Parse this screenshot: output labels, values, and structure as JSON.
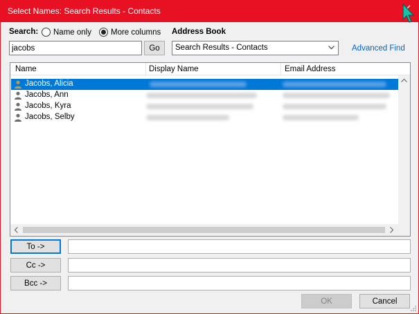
{
  "window": {
    "title": "Select Names: Search Results - Contacts"
  },
  "search": {
    "label": "Search:",
    "options": [
      "Name only",
      "More columns"
    ],
    "selected": "More columns",
    "query": "jacobs",
    "go_label": "Go"
  },
  "address_book": {
    "label": "Address Book",
    "selected": "Search Results - Contacts",
    "advanced_find": "Advanced Find"
  },
  "list": {
    "columns": [
      "Name",
      "Display Name",
      "Email Address"
    ],
    "rows": [
      {
        "name": "Jacobs, Alicia",
        "selected": true
      },
      {
        "name": "Jacobs, Ann",
        "selected": false
      },
      {
        "name": "Jacobs, Kyra",
        "selected": false
      },
      {
        "name": "Jacobs, Selby",
        "selected": false
      }
    ]
  },
  "recipients": {
    "to_label": "To ->",
    "cc_label": "Cc ->",
    "bcc_label": "Bcc ->"
  },
  "buttons": {
    "ok": "OK",
    "cancel": "Cancel"
  },
  "colors": {
    "titlebar": "#e81123",
    "selection": "#0078d7",
    "link": "#0066cc"
  },
  "icons": [
    "close-icon",
    "person-icon",
    "chevron-down-icon",
    "mouse-cursor-icon"
  ]
}
